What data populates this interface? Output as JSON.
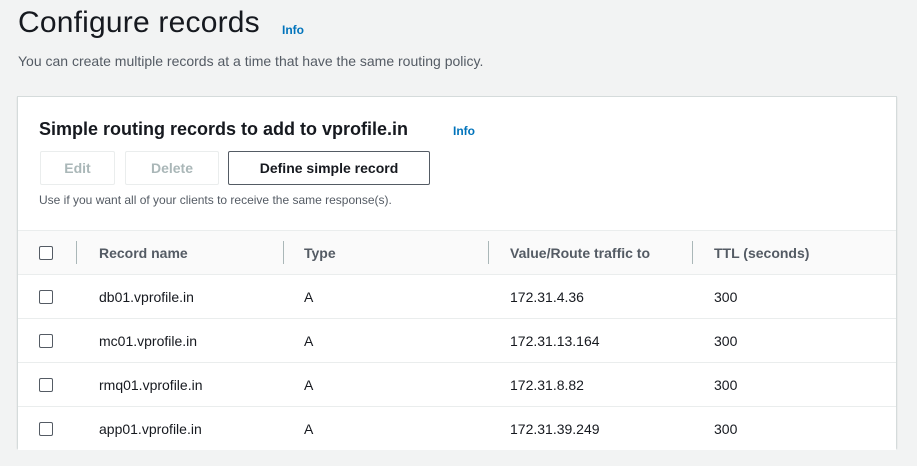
{
  "header": {
    "title": "Configure records",
    "info_label": "Info",
    "subtitle": "You can create multiple records at a time that have the same routing policy."
  },
  "panel": {
    "title": "Simple routing records to add to vprofile.in",
    "info_label": "Info",
    "buttons": {
      "edit": "Edit",
      "delete": "Delete",
      "define": "Define simple record"
    },
    "helper_text": "Use if you want all of your clients to receive the same response(s)."
  },
  "table": {
    "columns": [
      "Record name",
      "Type",
      "Value/Route traffic to",
      "TTL (seconds)"
    ],
    "rows": [
      {
        "name": "db01.vprofile.in",
        "type": "A",
        "value": "172.31.4.36",
        "ttl": "300"
      },
      {
        "name": "mc01.vprofile.in",
        "type": "A",
        "value": "172.31.13.164",
        "ttl": "300"
      },
      {
        "name": "rmq01.vprofile.in",
        "type": "A",
        "value": "172.31.8.82",
        "ttl": "300"
      },
      {
        "name": "app01.vprofile.in",
        "type": "A",
        "value": "172.31.39.249",
        "ttl": "300"
      }
    ]
  },
  "colors": {
    "link": "#0073bb",
    "background": "#f2f3f3",
    "panel": "#ffffff"
  }
}
